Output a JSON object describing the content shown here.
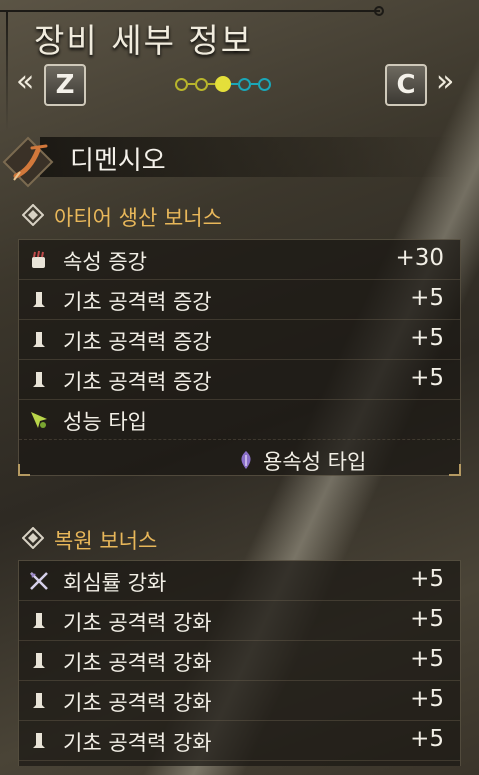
{
  "header": {
    "title": "장비 세부 정보",
    "prev_arrows": "«",
    "next_arrows": "»",
    "prev_key": "Z",
    "next_key": "C",
    "page_dots": [
      {
        "color": "#b8b52c",
        "active": false
      },
      {
        "color": "#b8b52c",
        "active": false
      },
      {
        "color": "#e4df3a",
        "active": true
      },
      {
        "color": "#1aa7b8",
        "active": false
      },
      {
        "color": "#1aa7b8",
        "active": false
      }
    ]
  },
  "weapon": {
    "name": "디멘시오",
    "icon": "bow-weapon-icon"
  },
  "artian_bonus": {
    "title": "아티어 생산 보너스",
    "rows": [
      {
        "label": "속성 증강",
        "value": "+30",
        "icon": "element-fist-icon"
      },
      {
        "label": "기초 공격력 증강",
        "value": "+5",
        "icon": "attack-icon"
      },
      {
        "label": "기초 공격력 증강",
        "value": "+5",
        "icon": "attack-icon"
      },
      {
        "label": "기초 공격력 증강",
        "value": "+5",
        "icon": "attack-icon"
      },
      {
        "label": "성능 타입",
        "value": "",
        "icon": "performance-arrow-icon"
      }
    ],
    "element_type": "용속성 타입"
  },
  "restore_bonus": {
    "title": "복원 보너스",
    "rows": [
      {
        "label": "회심률 강화",
        "value": "+5",
        "icon": "crossed-swords-icon"
      },
      {
        "label": "기초 공격력 강화",
        "value": "+5",
        "icon": "attack-icon"
      },
      {
        "label": "기초 공격력 강화",
        "value": "+5",
        "icon": "attack-icon"
      },
      {
        "label": "기초 공격력 강화",
        "value": "+5",
        "icon": "attack-icon"
      },
      {
        "label": "기초 공격력 강화",
        "value": "+5",
        "icon": "attack-icon"
      }
    ]
  },
  "colors": {
    "accent": "#e8b75a",
    "text": "#f2efe6"
  }
}
